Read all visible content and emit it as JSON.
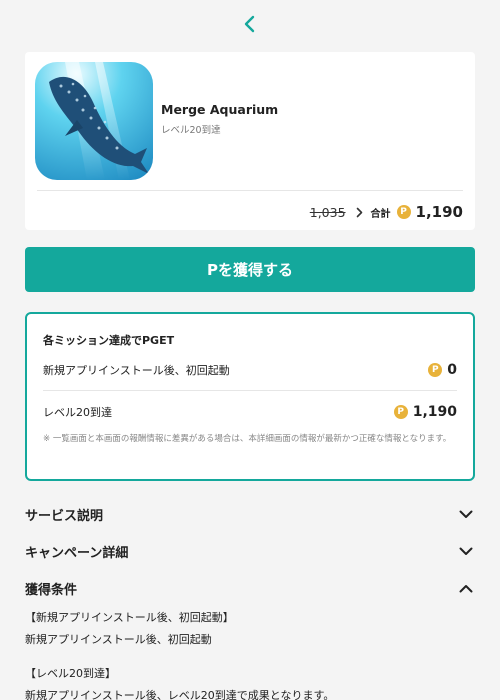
{
  "header": {
    "back_icon": "chevron-left-icon",
    "accent": "#14a89c"
  },
  "app": {
    "name": "Merge Aquarium",
    "subtitle": "レベル20到達",
    "icon": "whale-shark-app-icon",
    "old_points": "1,035",
    "total_label": "合計",
    "coin_symbol": "P",
    "total_points": "1,190"
  },
  "get_button": {
    "label": "Pを獲得する",
    "color": "#14a89c"
  },
  "missions": {
    "title": "各ミッション達成でPGET",
    "items": [
      {
        "label": "新規アプリインストール後、初回起動",
        "points": "0"
      },
      {
        "label": "レベル20到達",
        "points": "1,190"
      }
    ],
    "note": "※ 一覧画面と本画面の報酬情報に差異がある場合は、本詳細画面の情報が最新かつ正確な情報となります。"
  },
  "sections": {
    "service": {
      "title": "サービス説明",
      "expanded": false
    },
    "campaign": {
      "title": "キャンペーン詳細",
      "expanded": false
    },
    "conditions": {
      "title": "獲得条件",
      "expanded": true
    }
  },
  "conditions": {
    "block1_heading": "【新規アプリインストール後、初回起動】",
    "block1_body": "新規アプリインストール後、初回起動",
    "block2_heading": "【レベル20到達】",
    "block2_body": "新規アプリインストール後、レベル20到達で成果となります。"
  }
}
